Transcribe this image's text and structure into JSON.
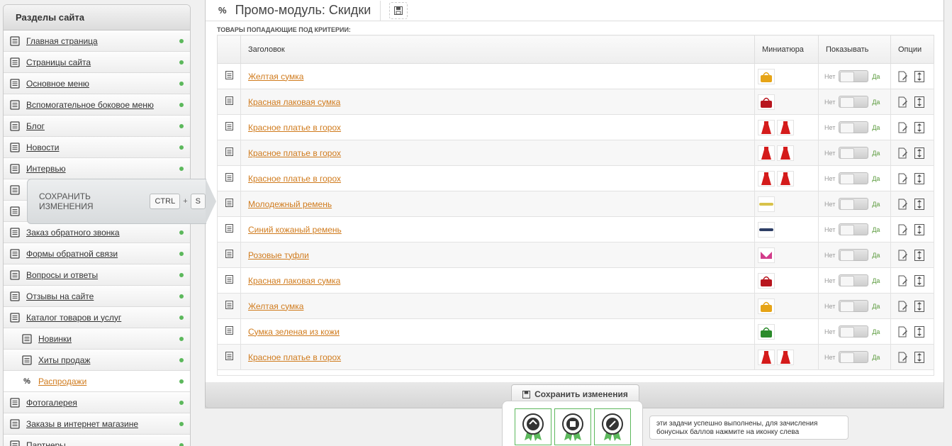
{
  "sidebar": {
    "title": "Разделы сайта",
    "items": [
      {
        "label": "Главная страница",
        "icon": "home-page-icon"
      },
      {
        "label": "Страницы сайта",
        "icon": "pages-icon"
      },
      {
        "label": "Основное меню",
        "icon": "menu-icon"
      },
      {
        "label": "Вспомогательное боковое меню",
        "icon": "side-menu-icon"
      },
      {
        "label": "Блог",
        "icon": "blog-icon"
      },
      {
        "label": "Новости",
        "icon": "news-icon"
      },
      {
        "label": "Интервью",
        "icon": "interview-icon"
      },
      {
        "label": "",
        "icon": "book-icon"
      },
      {
        "label": "",
        "icon": "code-icon"
      },
      {
        "label": "Заказ обратного звонка",
        "icon": "callback-icon"
      },
      {
        "label": "Формы обратной связи",
        "icon": "forms-icon"
      },
      {
        "label": "Вопросы и ответы",
        "icon": "faq-icon"
      },
      {
        "label": "Отзывы на сайте",
        "icon": "reviews-icon"
      },
      {
        "label": "Каталог товаров и услуг",
        "icon": "catalog-icon"
      }
    ],
    "sub_items": [
      {
        "label": "Новинки",
        "icon": "new-badge-icon"
      },
      {
        "label": "Хиты продаж",
        "icon": "hit-badge-icon"
      },
      {
        "label": "Распродажи",
        "icon": "percent-icon"
      }
    ],
    "tail_items": [
      {
        "label": "Фотогалерея",
        "icon": "camera-icon"
      },
      {
        "label": "Заказы в интернет магазине",
        "icon": "cart-icon"
      },
      {
        "label": "Партнеры",
        "icon": "partners-icon"
      }
    ]
  },
  "save_tip": {
    "text": "Сохранить изменения",
    "key1": "CTRL",
    "plus": "+",
    "key2": "S"
  },
  "header": {
    "percent": "%",
    "title": "Промо-модуль: Скидки"
  },
  "section_caption": "ТОВАРЫ ПОПАДАЮЩИЕ ПОД КРИТЕРИИ:",
  "table": {
    "columns": [
      "Заголовок",
      "Миниатюра",
      "Показывать",
      "Опции"
    ],
    "toggle_no": "Нет",
    "toggle_yes": "Да",
    "rows": [
      {
        "title": "Желтая сумка",
        "thumbs": [
          "yellow-bag"
        ]
      },
      {
        "title": "Красная лаковая сумка",
        "thumbs": [
          "red-bag"
        ]
      },
      {
        "title": "Красное платье в горох",
        "thumbs": [
          "red-dress",
          "red-dress"
        ]
      },
      {
        "title": "Красное платье в горох",
        "thumbs": [
          "red-dress",
          "red-dress"
        ]
      },
      {
        "title": "Красное платье в горох",
        "thumbs": [
          "red-dress",
          "red-dress"
        ]
      },
      {
        "title": "Молодежный ремень",
        "thumbs": [
          "yellow-belt"
        ]
      },
      {
        "title": "Синий кожаный ремень",
        "thumbs": [
          "blue-belt"
        ]
      },
      {
        "title": "Розовые туфли",
        "thumbs": [
          "pink-shoes"
        ]
      },
      {
        "title": "Красная лаковая сумка",
        "thumbs": [
          "red-bag"
        ]
      },
      {
        "title": "Желтая сумка",
        "thumbs": [
          "yellow-bag"
        ]
      },
      {
        "title": "Сумка зеленая из кожи",
        "thumbs": [
          "green-bag"
        ]
      },
      {
        "title": "Красное платье в горох",
        "thumbs": [
          "red-dress",
          "red-dress"
        ]
      }
    ]
  },
  "footer": {
    "save_label": "Сохранить изменения",
    "task_note": "эти задачи успешно выполнены, для зачисления бонусных баллов нажмите на иконку слева"
  },
  "colors": {
    "link": "#d07b1d",
    "status_dot": "#5cb85c",
    "toggle_yes": "#5a9a3c"
  }
}
